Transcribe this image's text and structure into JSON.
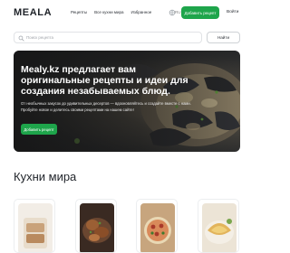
{
  "header": {
    "logo": "MEALA",
    "nav": [
      "Рецепты",
      "Все кухни мира",
      "Избранное"
    ],
    "lang": "RU",
    "add_recipe_label": "Добавить рецепт",
    "login_label": "Войти"
  },
  "search": {
    "placeholder": "Поиск рецепта",
    "button_label": "Найти"
  },
  "hero": {
    "title": "Mealy.kz предлагает вам оригинальные рецепты и идеи для создания незабываемых блюд.",
    "subtitle_line1": "От необычных закусок до удивительных десертов — вдохновляйтесь и создайте вместе с нами.",
    "subtitle_line2": "Пробуйте новое и делитесь своими рецептами на нашем сайте!",
    "button_label": "Добавить рецепт"
  },
  "section": {
    "title": "Кухни мира"
  },
  "colors": {
    "accent": "#1ea54b",
    "text": "#1f2329"
  }
}
